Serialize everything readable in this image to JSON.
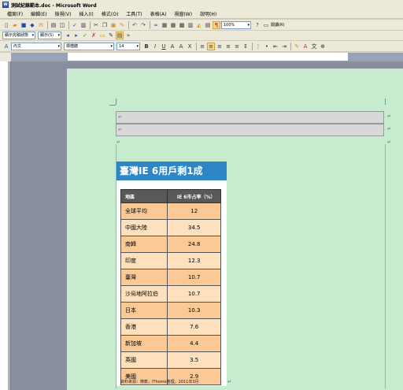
{
  "window": {
    "title": "測試紀錄範本.doc - Microsoft Word"
  },
  "menu": {
    "items": [
      "檔案(F)",
      "編輯(E)",
      "檢視(V)",
      "插入(I)",
      "格式(O)",
      "工具(T)",
      "表格(A)",
      "視窗(W)",
      "說明(H)"
    ]
  },
  "toolbar": {
    "zoom": "100%",
    "read_label": "閱讀(R)",
    "markup_dropdown": "顯示完稿狀態",
    "show_dropdown": "顯示(S)",
    "style_dropdown": "內文",
    "font_dropdown": "標楷體",
    "size_dropdown": "14"
  },
  "infographic": {
    "title": "臺灣IE 6用戶剩1成",
    "header_region": "地區",
    "header_share": "IE 6市占率（%）",
    "rows": [
      {
        "region": "全球平均",
        "share": "12"
      },
      {
        "region": "中國大陸",
        "share": "34.5"
      },
      {
        "region": "南韓",
        "share": "24.8"
      },
      {
        "region": "印度",
        "share": "12.3"
      },
      {
        "region": "臺灣",
        "share": "10.7"
      },
      {
        "region": "沙烏地阿拉伯",
        "share": "10.7"
      },
      {
        "region": "日本",
        "share": "10.3"
      },
      {
        "region": "香港",
        "share": "7.6"
      },
      {
        "region": "新加坡",
        "share": "4.4"
      },
      {
        "region": "英國",
        "share": "3.5"
      },
      {
        "region": "美國",
        "share": "2.9"
      }
    ],
    "source": "資料來源：微軟，iThome整理，2011年3月"
  },
  "colors": {
    "page": "#c7ebcf",
    "title_bg": "#2f86c7",
    "row_dark": "#fbc995",
    "row_light": "#fde0bd"
  }
}
